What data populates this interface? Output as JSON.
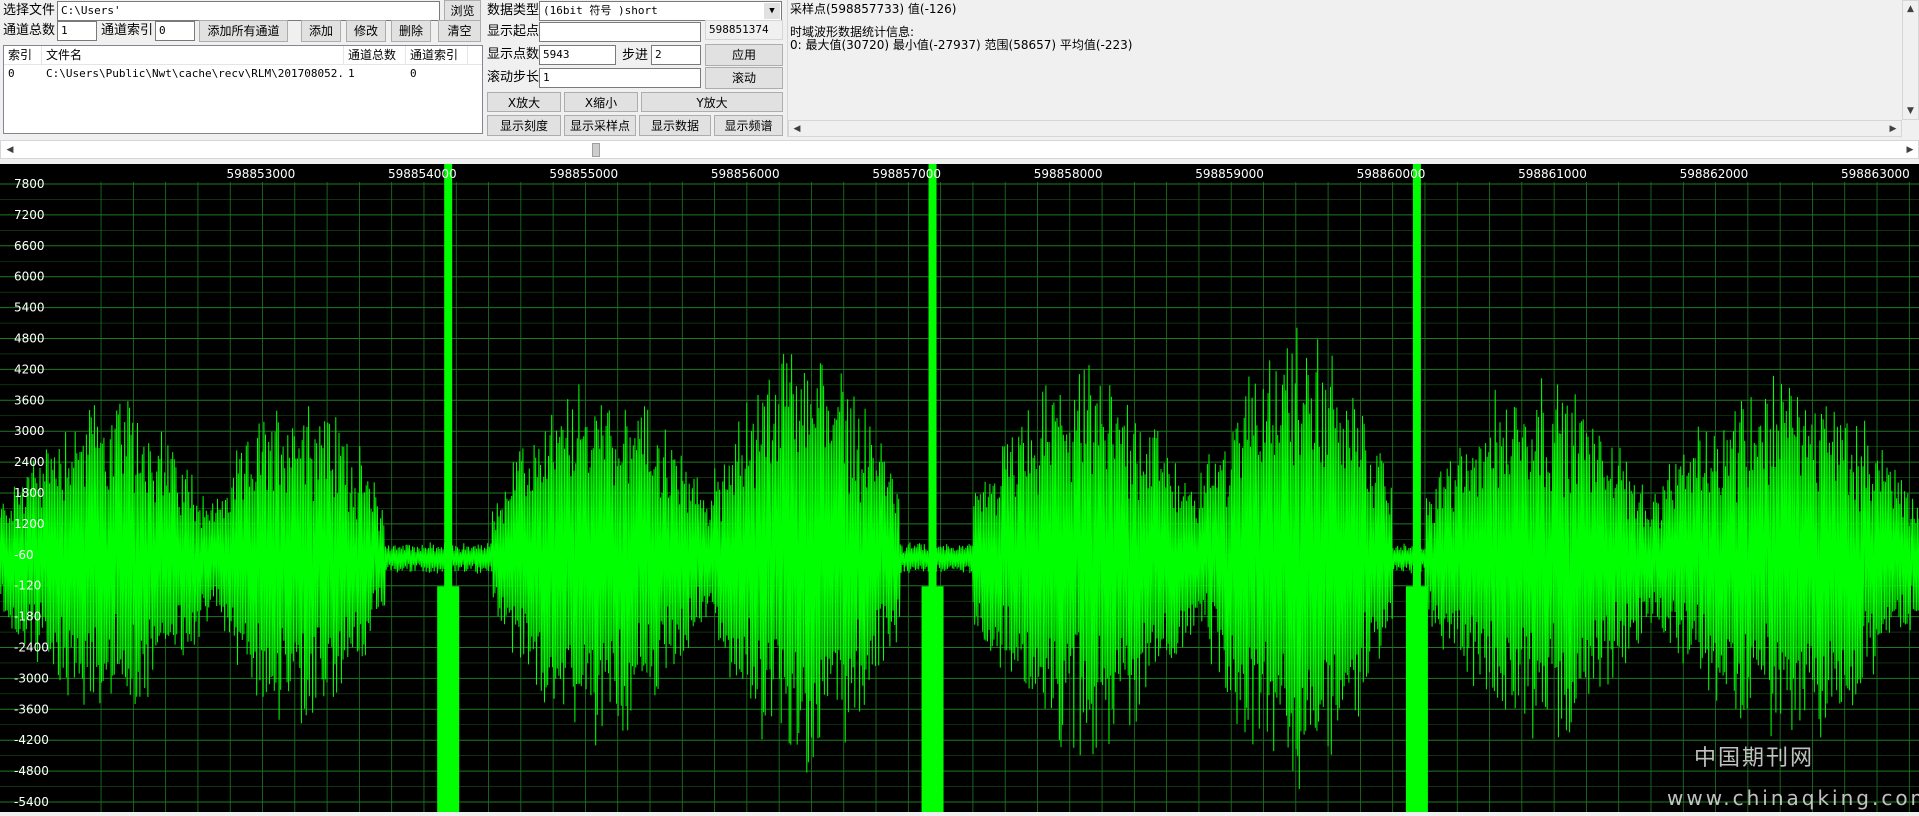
{
  "controls": {
    "select_file_label": "选择文件",
    "file_path": "C:\\Users'",
    "browse_button": "浏览",
    "channel_total_label": "通道总数",
    "channel_total_value": "1",
    "channel_index_label": "通道索引",
    "channel_index_value": "0",
    "add_all_button": "添加所有通道",
    "add_button": "添加",
    "modify_button": "修改",
    "delete_button": "删除",
    "clear_button": "清空"
  },
  "file_list": {
    "columns": [
      "索引",
      "文件名",
      "通道总数",
      "通道索引"
    ],
    "rows": [
      {
        "index": "0",
        "file": "C:\\Users\\Public\\Nwt\\cache\\recv\\RLM\\201708052...",
        "total": "1",
        "channel": "0"
      }
    ]
  },
  "settings": {
    "data_type_label": "数据类型",
    "data_type_value": "(16bit 符号  )short",
    "start_label": "显示起点",
    "start_value": "",
    "start_readout": "598851374",
    "points_label": "显示点数",
    "points_value": "5943",
    "step_label": "步进",
    "step_value": "2",
    "apply_button": "应用",
    "scroll_step_label": "滚动步长",
    "scroll_step_value": "1",
    "scroll_button": "滚动",
    "x_zoom_in": "X放大",
    "x_zoom_out": "X缩小",
    "y_zoom_in": "Y放大",
    "show_scale": "显示刻度",
    "show_samples": "显示采样点",
    "show_data": "显示数据",
    "show_spectrum": "显示频谱"
  },
  "info": {
    "sample_line": "采样点(598857733) 值(-126)",
    "stats_title": "时域波形数据统计信息:",
    "stats_line": "0: 最大值(30720) 最小值(-27937) 范围(58657) 平均值(-223)"
  },
  "horizontal_scroll": {
    "position_fraction": 0.305
  },
  "chart_data": {
    "type": "line",
    "x_ticks": [
      "598853000",
      "598854000",
      "598855000",
      "598856000",
      "598857000",
      "598858000",
      "598859000",
      "598860000",
      "598861000",
      "598862000",
      "598863000"
    ],
    "x_tick_values": [
      598853000,
      598854000,
      598855000,
      598856000,
      598857000,
      598858000,
      598859000,
      598860000,
      598861000,
      598862000,
      598863000
    ],
    "xlim": [
      598851374,
      598863260
    ],
    "y_ticks": [
      "7800",
      "7200",
      "6600",
      "6000",
      "5400",
      "4800",
      "4200",
      "3600",
      "3000",
      "2400",
      "1800",
      "1200",
      "-60",
      "-120",
      "-180",
      "-2400",
      "-3000",
      "-3600",
      "-4200",
      "-4800",
      "-5400"
    ],
    "ylim": [
      -5400,
      8000
    ],
    "grid": true,
    "series_color": "#00ff00",
    "grid_color": "#1f7a1f",
    "spikes": [
      598854150,
      598857150,
      598860150
    ],
    "bursts": [
      {
        "start": 598851374,
        "end": 598852700,
        "amp": 3200
      },
      {
        "start": 598852700,
        "end": 598853760,
        "amp": 3300
      },
      {
        "start": 598854420,
        "end": 598855770,
        "amp": 3500
      },
      {
        "start": 598855770,
        "end": 598856950,
        "amp": 4300
      },
      {
        "start": 598857400,
        "end": 598858800,
        "amp": 3700
      },
      {
        "start": 598858800,
        "end": 598860000,
        "amp": 4500
      },
      {
        "start": 598860200,
        "end": 598861600,
        "amp": 3600
      },
      {
        "start": 598861600,
        "end": 598863260,
        "amp": 3600
      }
    ]
  },
  "watermark": {
    "cn": "中国期刊网",
    "url": "www.chinaqking.com"
  }
}
